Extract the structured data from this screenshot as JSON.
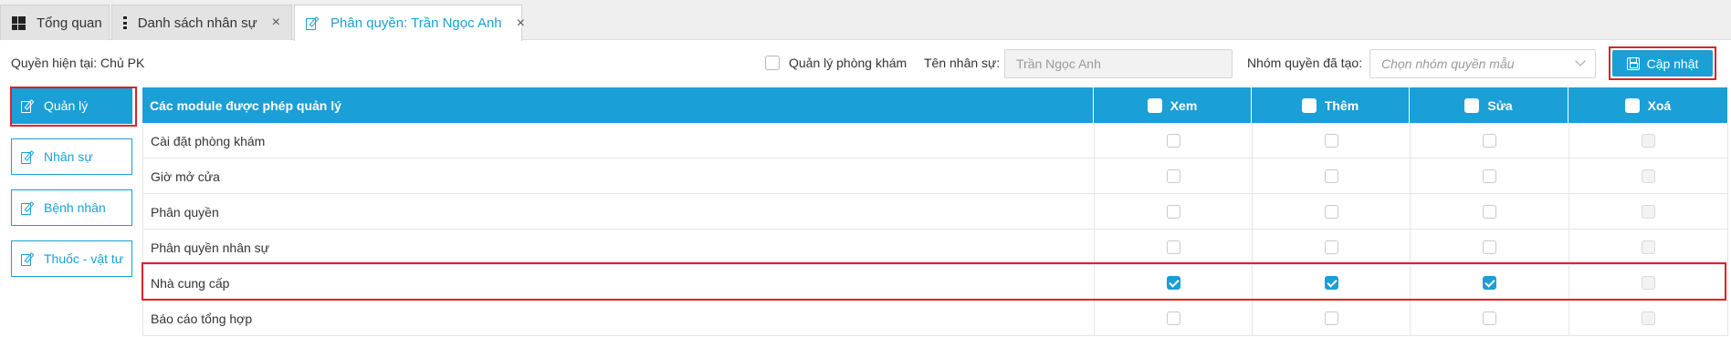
{
  "tabs": [
    {
      "label": "Tổng quan",
      "icon": "dashboard-icon",
      "closable": false
    },
    {
      "label": "Danh sách nhân sự",
      "icon": "list-icon",
      "closable": true,
      "close": "×"
    },
    {
      "label": "Phân quyền: Trần Ngọc Anh",
      "icon": "edit-icon",
      "closable": true,
      "close": "×",
      "active": true
    }
  ],
  "toolbar": {
    "current_role": "Quyền hiện tại: Chủ PK",
    "clinic_manager_label": "Quản lý phòng khám",
    "staff_name_label": "Tên nhân sự:",
    "staff_name_value": "Trần Ngọc Anh",
    "group_label": "Nhóm quyền đã tạo:",
    "group_placeholder": "Chọn nhóm quyền mẫu",
    "update_label": "Cập nhật"
  },
  "sidebar": {
    "items": [
      {
        "label": "Quản lý",
        "active": true
      },
      {
        "label": "Nhân sự",
        "active": false
      },
      {
        "label": "Bệnh nhân",
        "active": false
      },
      {
        "label": "Thuốc - vật tư",
        "active": false
      }
    ]
  },
  "table": {
    "headers": {
      "module": "Các module được phép quản lý",
      "view": "Xem",
      "add": "Thêm",
      "edit": "Sửa",
      "delete": "Xoá"
    },
    "rows": [
      {
        "module": "Cài đặt phòng khám",
        "view": false,
        "add": false,
        "edit": false,
        "delete": false,
        "delete_disabled": true
      },
      {
        "module": "Giờ mở cửa",
        "view": false,
        "add": false,
        "edit": false,
        "delete": false,
        "delete_disabled": true
      },
      {
        "module": "Phân quyền",
        "view": false,
        "add": false,
        "edit": false,
        "delete": false,
        "delete_disabled": true
      },
      {
        "module": "Phân quyền nhân sự",
        "view": false,
        "add": false,
        "edit": false,
        "delete": false,
        "delete_disabled": true
      },
      {
        "module": "Nhà cung cấp",
        "view": true,
        "add": true,
        "edit": true,
        "delete": false,
        "delete_disabled": true,
        "highlighted": true
      },
      {
        "module": "Báo cáo tổng hợp",
        "view": false,
        "add": false,
        "edit": false,
        "delete": false,
        "delete_disabled": true
      }
    ]
  },
  "colors": {
    "accent": "#1a9fd6",
    "highlight": "#e0202a"
  }
}
